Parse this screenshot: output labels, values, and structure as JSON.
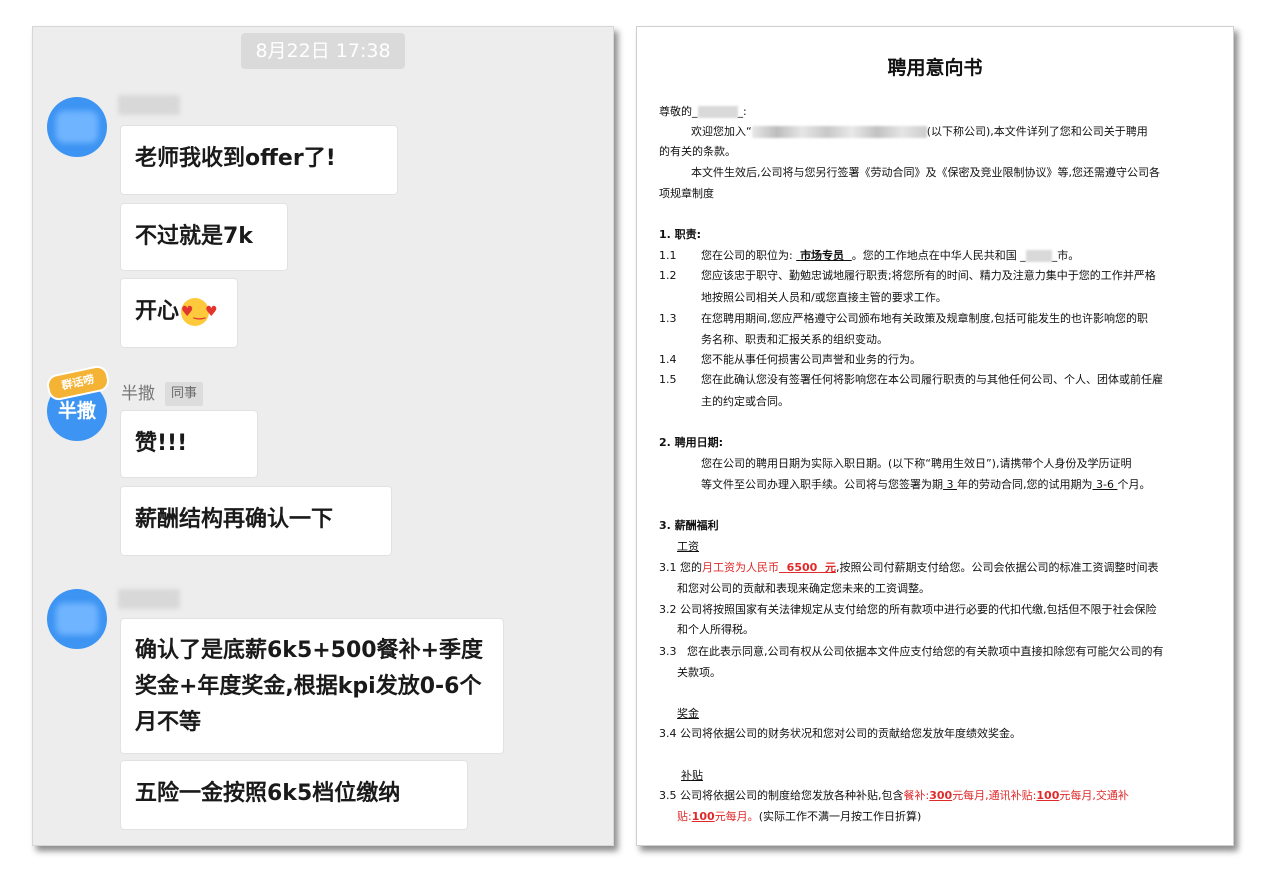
{
  "chat": {
    "timestamp": "8月22日 17:38",
    "avatar2_text": "半撒",
    "avatar2_badge": "群话唠",
    "sender2_name": "半撒",
    "sender2_tag": "同事",
    "messages": [
      "老师我收到offer了!",
      "不过就是7k",
      "开心",
      "赞!!!",
      "薪酬结构再确认一下",
      "确认了是底薪6k5+500餐补+季度奖金+年度奖金,根据kpi发放0-6个月不等",
      "五险一金按照6k5档位缴纳"
    ]
  },
  "letter": {
    "title": "聘用意向书",
    "salutation_prefix": "尊敬的",
    "intro1_a": "欢迎您加入“",
    "intro1_b": "(以下称公司),本文件详列了您和公司关于聘用",
    "intro1_c": "的有关的条款。",
    "intro2_a": "本文件生效后,公司将与您另行签署《劳动合同》及《保密及竞业限制协议》等,您还需遵守公司各",
    "intro2_b": "项规章制度",
    "s1_title": "1.   职责:",
    "s1_1_num": "1.1",
    "s1_1_a": "您在公司的职位为:",
    "s1_1_position": "市场专员",
    "s1_1_b": "。您的工作地点在中华人民共和国",
    "s1_1_c": "市。",
    "s1_2_num": "1.2",
    "s1_2_a": "您应该忠于职守、勤勉忠诚地履行职责;将您所有的时间、精力及注意力集中于您的工作并严格",
    "s1_2_b": "地按照公司相关人员和/或您直接主管的要求工作。",
    "s1_3_num": "1.3",
    "s1_3_a": "在您聘用期间,您应严格遵守公司颁布地有关政策及规章制度,包括可能发生的也许影响您的职",
    "s1_3_b": "务名称、职责和汇报关系的组织变动。",
    "s1_4_num": "1.4",
    "s1_4_a": "您不能从事任何损害公司声誉和业务的行为。",
    "s1_5_num": "1.5",
    "s1_5_a": "您在此确认您没有签署任何将影响您在本公司履行职责的与其他任何公司、个人、团体或前任雇",
    "s1_5_b": "主的约定或合同。",
    "s2_title": "2.   聘用日期:",
    "s2_a": "您在公司的聘用日期为实际入职日期。(以下称“聘用生效日”),请携带个人身份及学历证明",
    "s2_b1": "等文件至公司办理入职手续。公司将与您签署为期",
    "s2_term": "3",
    "s2_b2": "年的劳动合同,您的试用期为",
    "s2_probation": "3-6",
    "s2_b3": "个月。",
    "s3_title": "3.    薪酬福利",
    "s3_salary_head": "工资",
    "s3_1_num": "3.1",
    "s3_1_a": "您的",
    "s3_1_red": "月工资为人民币",
    "s3_1_amount": "6500",
    "s3_1_unit": "元",
    "s3_1_b": ",按照公司付薪期支付给您。公司会依据公司的标准工资调整时间表",
    "s3_1_c": "和您对公司的贡献和表现来确定您未来的工资调整。",
    "s3_2_num": "3.2",
    "s3_2_a": "公司将按照国家有关法律规定从支付给您的所有款项中进行必要的代扣代缴,包括但不限于社会保险",
    "s3_2_b": "和个人所得税。",
    "s3_3_num": "3.3",
    "s3_3_a": "您在此表示同意,公司有权从公司依据本文件应支付给您的有关款项中直接扣除您有可能欠公司的有",
    "s3_3_b": "关款项。",
    "s3_bonus_head": "奖金",
    "s3_4_num": "3.4",
    "s3_4_a": "公司将依据公司的财务状况和您对公司的贡献给您发放年度绩效奖金。",
    "s3_allow_head": "补贴",
    "s3_5_num": "3.5",
    "s3_5_a": "公司将依据公司的制度给您发放各种补贴,包含",
    "s3_5_meal_label": "餐补:",
    "s3_5_meal_amt": "300",
    "s3_5_meal_unit": "元每月,通讯补贴:",
    "s3_5_comm_amt": "100",
    "s3_5_comm_unit": "元每月,交通补",
    "s3_5_trans_label": "贴:",
    "s3_5_trans_amt": "100",
    "s3_5_trans_unit": "元每月。",
    "s3_5_note": "(实际工作不满一月按工作日折算)"
  }
}
